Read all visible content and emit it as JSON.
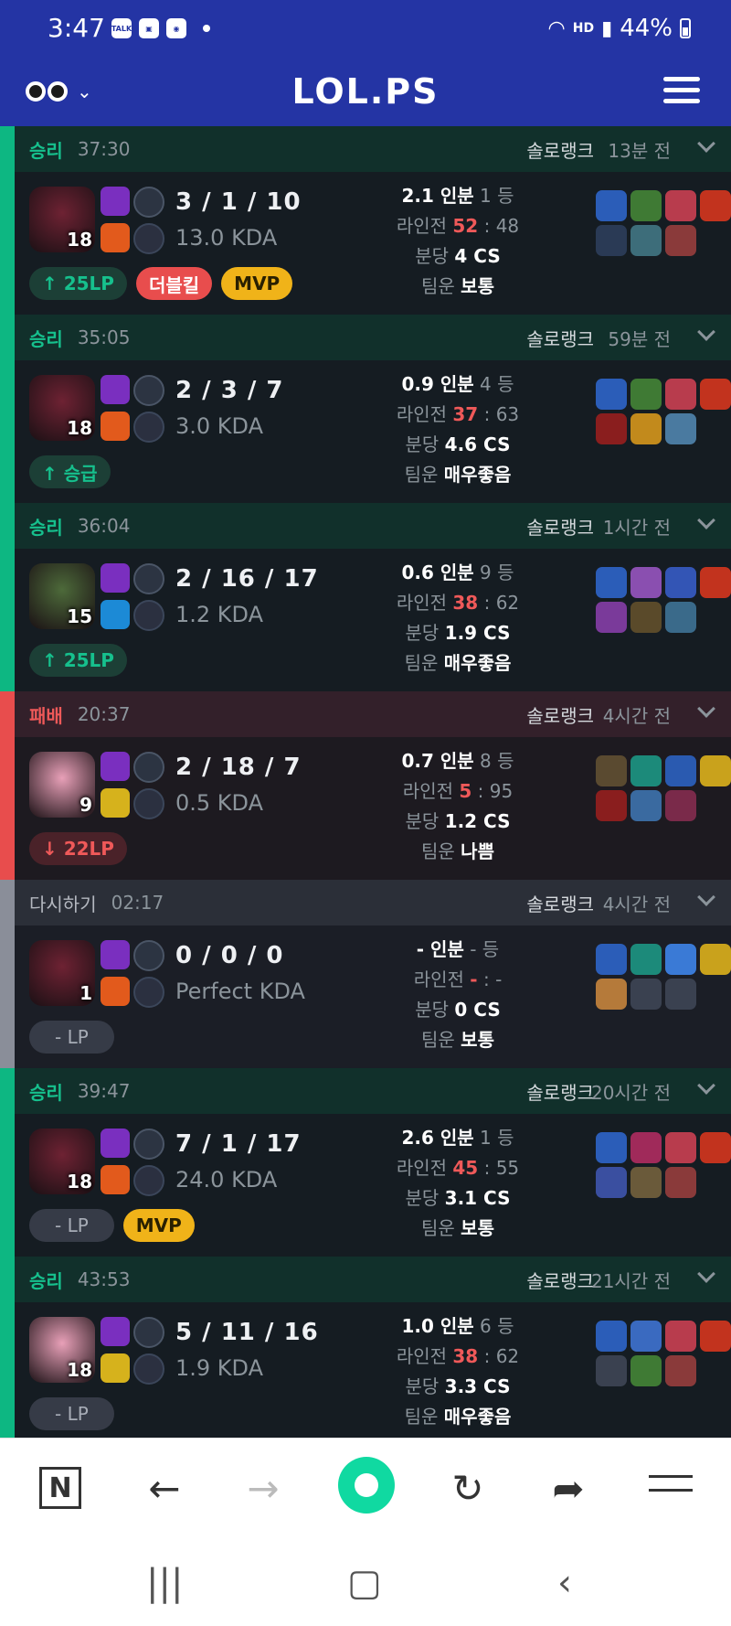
{
  "status": {
    "time": "3:47",
    "battery": "44%",
    "icons": [
      "talk-icon",
      "gallery-icon",
      "app-icon"
    ],
    "hd": "HD"
  },
  "header": {
    "title": "LOL.PS"
  },
  "matches": [
    {
      "result": "승리",
      "duration": "37:30",
      "queue": "솔로랭크",
      "ago": "13분 전",
      "type": "win",
      "level": "18",
      "kda": "3 / 1 / 10",
      "kda_ratio": "13.0 KDA",
      "lp": "↑ 25LP",
      "badges": [
        "더블킬",
        "MVP"
      ],
      "share": "2.1 인분",
      "rank": "1 등",
      "lane_label": "라인전",
      "lane_a": "52",
      "lane_b": "48",
      "cs_label": "분당",
      "cs": "4 CS",
      "luck_label": "팀운",
      "luck": "보통",
      "champ_color": "#6e2233",
      "spell1": "#7a2fbf",
      "spell2": "#e25a1c",
      "items": [
        "#2b5db8",
        "#3f7a34",
        "#b83c4d",
        "#c2331e",
        "#2a3a55",
        "#3d6d7a",
        "#8a3a3a",
        ""
      ]
    },
    {
      "result": "승리",
      "duration": "35:05",
      "queue": "솔로랭크",
      "ago": "59분 전",
      "type": "win",
      "level": "18",
      "kda": "2 / 3 / 7",
      "kda_ratio": "3.0 KDA",
      "lp": "↑ 승급",
      "badges": [],
      "share": "0.9 인분",
      "rank": "4 등",
      "lane_label": "라인전",
      "lane_a": "37",
      "lane_b": "63",
      "cs_label": "분당",
      "cs": "4.6 CS",
      "luck_label": "팀운",
      "luck": "매우좋음",
      "champ_color": "#6e2233",
      "spell1": "#7a2fbf",
      "spell2": "#e25a1c",
      "items": [
        "#2b5db8",
        "#3f7a34",
        "#b83c4d",
        "#c2331e",
        "#8a1e1e",
        "#c28a1c",
        "#4a7aa0",
        ""
      ]
    },
    {
      "result": "승리",
      "duration": "36:04",
      "queue": "솔로랭크",
      "ago": "1시간 전",
      "type": "win",
      "level": "15",
      "kda": "2 / 16 / 17",
      "kda_ratio": "1.2 KDA",
      "lp": "↑ 25LP",
      "badges": [],
      "share": "0.6 인분",
      "rank": "9 등",
      "lane_label": "라인전",
      "lane_a": "38",
      "lane_b": "62",
      "cs_label": "분당",
      "cs": "1.9 CS",
      "luck_label": "팀운",
      "luck": "매우좋음",
      "champ_color": "#4d6a3a",
      "spell1": "#7a2fbf",
      "spell2": "#1c8ad6",
      "items": [
        "#2b5db8",
        "#8a4fb0",
        "#3355b5",
        "#c2331e",
        "#7a3a9a",
        "#5a4a2a",
        "#3a6a8a",
        ""
      ]
    },
    {
      "result": "패배",
      "duration": "20:37",
      "queue": "솔로랭크",
      "ago": "4시간 전",
      "type": "loss",
      "level": "9",
      "kda": "2 / 18 / 7",
      "kda_ratio": "0.5 KDA",
      "lp": "↓ 22LP",
      "badges": [],
      "share": "0.7 인분",
      "rank": "8 등",
      "lane_label": "라인전",
      "lane_a": "5",
      "lane_b": "95",
      "cs_label": "분당",
      "cs": "1.2 CS",
      "luck_label": "팀운",
      "luck": "나쁨",
      "champ_color": "#e8a0b8",
      "spell1": "#7a2fbf",
      "spell2": "#d6b21c",
      "items": [
        "#5a4a30",
        "#1c8a7a",
        "#2a5ab0",
        "#c9a21c",
        "#8a1e1e",
        "#3a6aa0",
        "#7a2a4a",
        ""
      ]
    },
    {
      "result": "다시하기",
      "duration": "02:17",
      "queue": "솔로랭크",
      "ago": "4시간 전",
      "type": "remake",
      "level": "1",
      "kda": "0 / 0 / 0",
      "kda_ratio": "Perfect KDA",
      "lp": "- LP",
      "badges": [],
      "share": "- 인분",
      "rank": "- 등",
      "lane_label": "라인전",
      "lane_a": "-",
      "lane_b": "-",
      "cs_label": "분당",
      "cs": "0 CS",
      "luck_label": "팀운",
      "luck": "보통",
      "champ_color": "#6e2233",
      "spell1": "#7a2fbf",
      "spell2": "#e25a1c",
      "items": [
        "#2b5db8",
        "#1c8a7a",
        "#3a7ad6",
        "#c9a21c",
        "#b57a3a",
        "",
        "",
        ""
      ]
    },
    {
      "result": "승리",
      "duration": "39:47",
      "queue": "솔로랭크",
      "ago": "20시간 전",
      "type": "win",
      "level": "18",
      "kda": "7 / 1 / 17",
      "kda_ratio": "24.0 KDA",
      "lp": "- LP",
      "badges": [
        "MVP"
      ],
      "share": "2.6 인분",
      "rank": "1 등",
      "lane_label": "라인전",
      "lane_a": "45",
      "lane_b": "55",
      "cs_label": "분당",
      "cs": "3.1 CS",
      "luck_label": "팀운",
      "luck": "보통",
      "champ_color": "#6e2233",
      "spell1": "#7a2fbf",
      "spell2": "#e25a1c",
      "items": [
        "#2b5db8",
        "#a02a5a",
        "#b83c4d",
        "#c2331e",
        "#3a4fa0",
        "#6a5a3a",
        "#8a3a3a",
        ""
      ]
    },
    {
      "result": "승리",
      "duration": "43:53",
      "queue": "솔로랭크",
      "ago": "21시간 전",
      "type": "win",
      "level": "18",
      "kda": "5 / 11 / 16",
      "kda_ratio": "1.9 KDA",
      "lp": "- LP",
      "badges": [],
      "share": "1.0 인분",
      "rank": "6 등",
      "lane_label": "라인전",
      "lane_a": "38",
      "lane_b": "62",
      "cs_label": "분당",
      "cs": "3.3 CS",
      "luck_label": "팀운",
      "luck": "매우좋음",
      "champ_color": "#e8a0b8",
      "spell1": "#7a2fbf",
      "spell2": "#d6b21c",
      "items": [
        "#2b5db8",
        "#3a6ac0",
        "#b83c4d",
        "#c2331e",
        "",
        "#3f7a34",
        "#8a3a3a",
        ""
      ]
    }
  ],
  "nav": {
    "n_label": "N",
    "back": "←",
    "forward": "→",
    "reload": "↻",
    "share": "➦"
  },
  "system": {
    "recents": "|||",
    "home": "▢",
    "back": "‹"
  }
}
